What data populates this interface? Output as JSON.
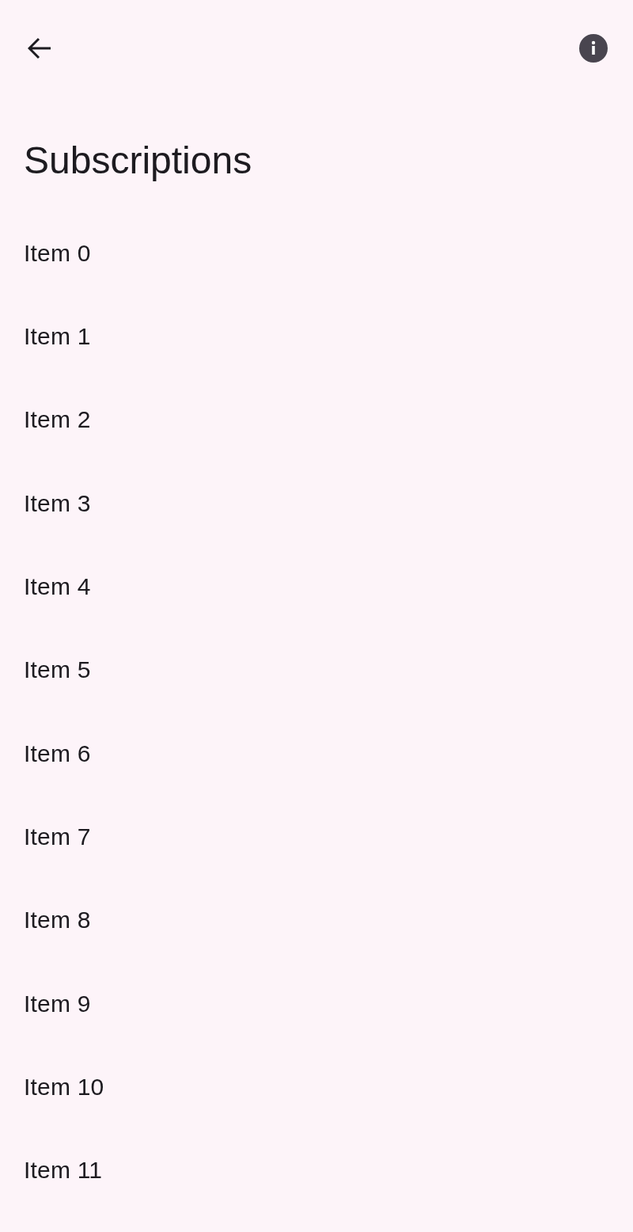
{
  "title": "Subscriptions",
  "items": [
    {
      "label": "Item 0"
    },
    {
      "label": "Item 1"
    },
    {
      "label": "Item 2"
    },
    {
      "label": "Item 3"
    },
    {
      "label": "Item 4"
    },
    {
      "label": "Item 5"
    },
    {
      "label": "Item 6"
    },
    {
      "label": "Item 7"
    },
    {
      "label": "Item 8"
    },
    {
      "label": "Item 9"
    },
    {
      "label": "Item 10"
    },
    {
      "label": "Item 11"
    }
  ]
}
